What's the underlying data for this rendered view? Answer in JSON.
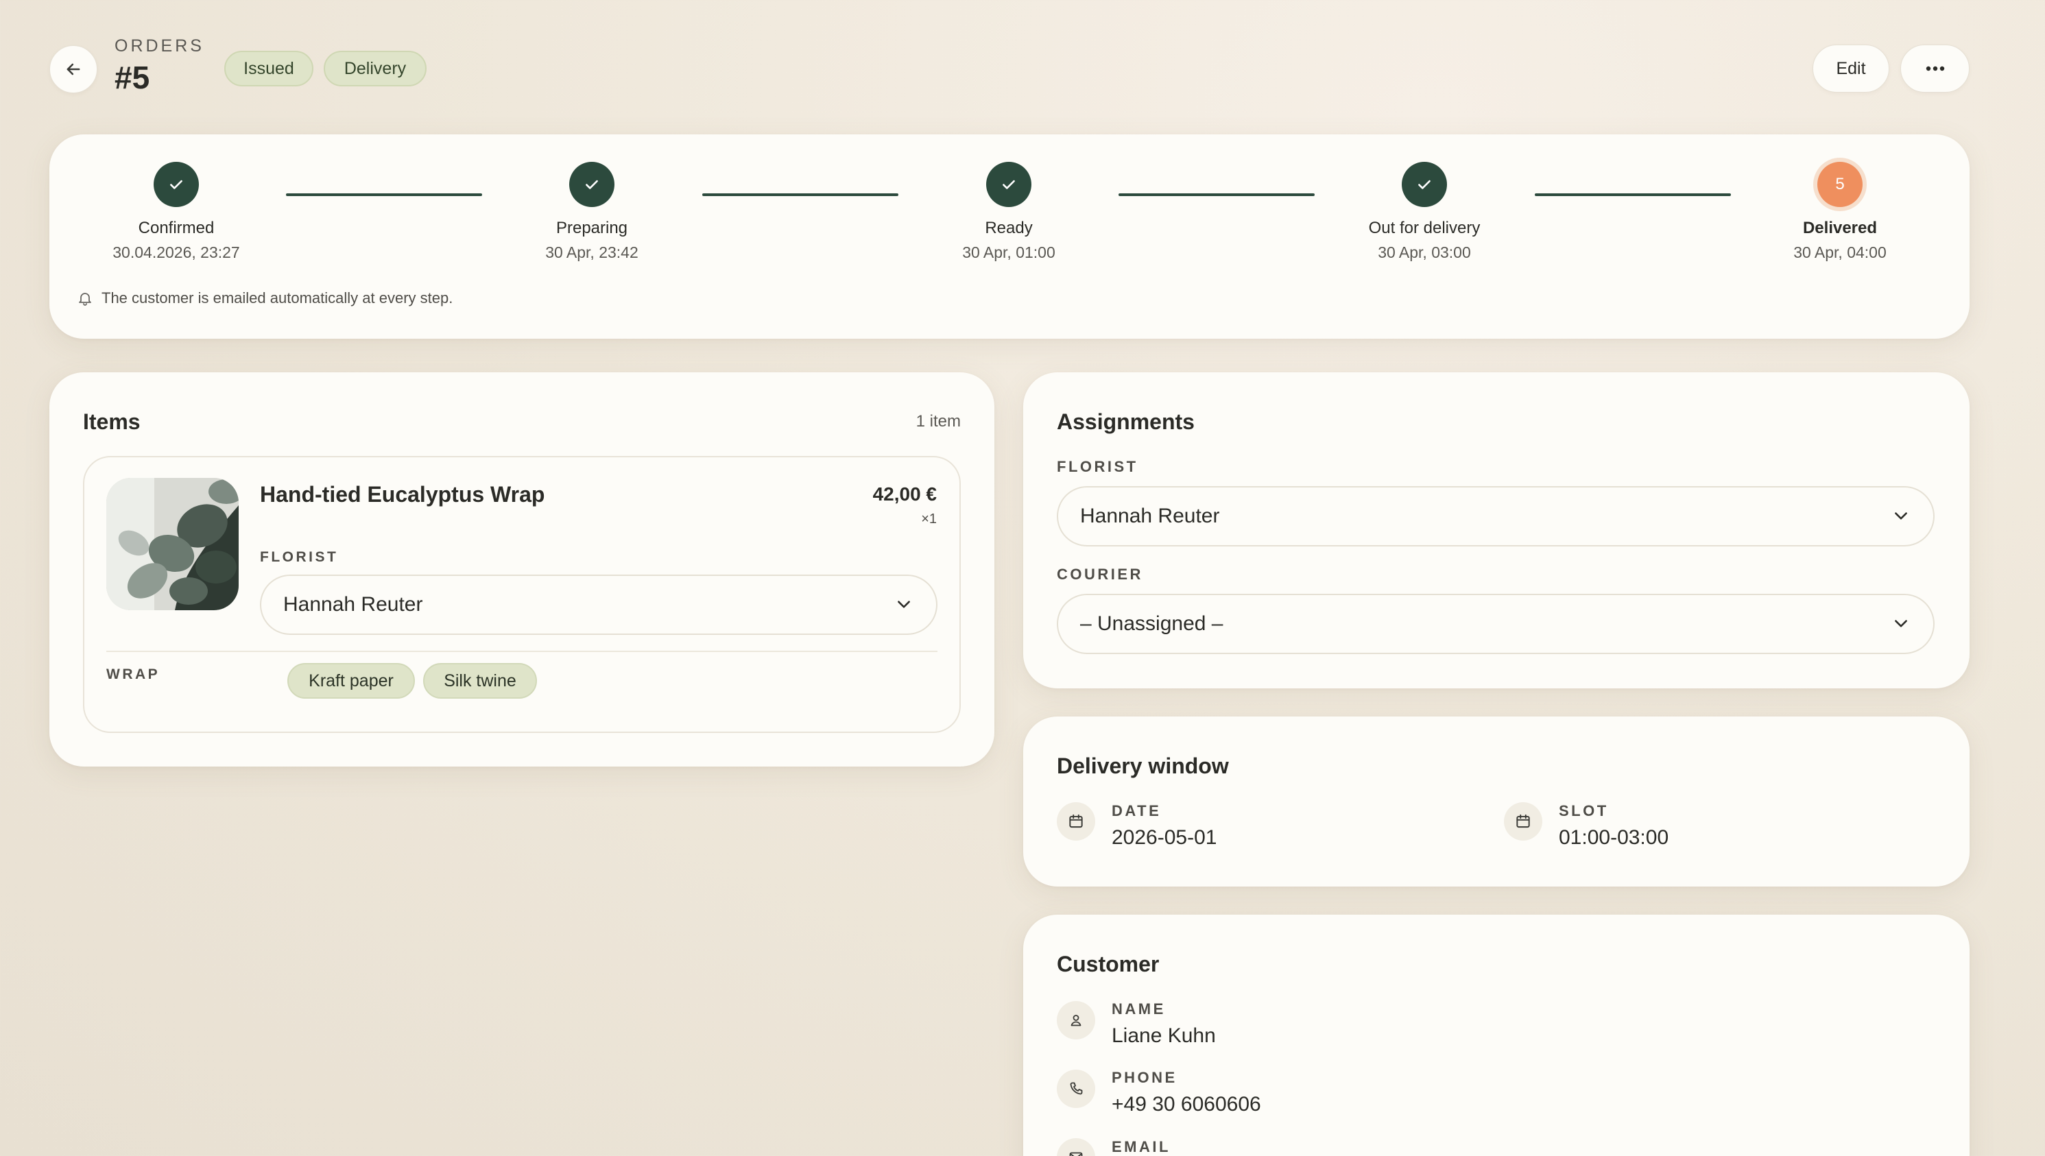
{
  "header": {
    "breadcrumb": "ORDERS",
    "order_number": "#5",
    "badges": [
      "Issued",
      "Delivery"
    ],
    "edit_label": "Edit"
  },
  "progress": {
    "steps": [
      {
        "label": "Confirmed",
        "date": "30.04.2026, 23:27",
        "state": "done"
      },
      {
        "label": "Preparing",
        "date": "30 Apr, 23:42",
        "state": "done"
      },
      {
        "label": "Ready",
        "date": "30 Apr, 01:00",
        "state": "done"
      },
      {
        "label": "Out for delivery",
        "date": "30 Apr, 03:00",
        "state": "done"
      },
      {
        "label": "Delivered",
        "date": "30 Apr, 04:00",
        "state": "current",
        "number": "5"
      }
    ],
    "note": "The customer is emailed automatically at every step."
  },
  "items": {
    "title": "Items",
    "count": "1 item",
    "list": [
      {
        "name": "Hand-tied Eucalyptus Wrap",
        "price": "42,00 €",
        "qty": "×1",
        "florist_label": "FLORIST",
        "florist_value": "Hannah Reuter",
        "wrap_label": "WRAP",
        "wrap_options": [
          "Kraft paper",
          "Silk twine"
        ]
      }
    ]
  },
  "assignments": {
    "title": "Assignments",
    "florist_label": "FLORIST",
    "florist_value": "Hannah Reuter",
    "courier_label": "COURIER",
    "courier_value": "– Unassigned –"
  },
  "delivery_window": {
    "title": "Delivery window",
    "date_label": "DATE",
    "date_value": "2026-05-01",
    "slot_label": "SLOT",
    "slot_value": "01:00-03:00"
  },
  "customer": {
    "title": "Customer",
    "name_label": "NAME",
    "name_value": "Liane Kuhn",
    "phone_label": "PHONE",
    "phone_value": "+49 30 6060606",
    "email_label": "EMAIL"
  },
  "colors": {
    "accent_green": "#2c4a3d",
    "current_step_orange": "#ef8f5e",
    "badge_bg": "#dfe4c9"
  },
  "icons": [
    "back-arrow-icon",
    "more-icon",
    "check-icon",
    "bell-icon",
    "chevron-down-icon",
    "calendar-icon",
    "user-icon",
    "phone-icon",
    "mail-icon"
  ]
}
